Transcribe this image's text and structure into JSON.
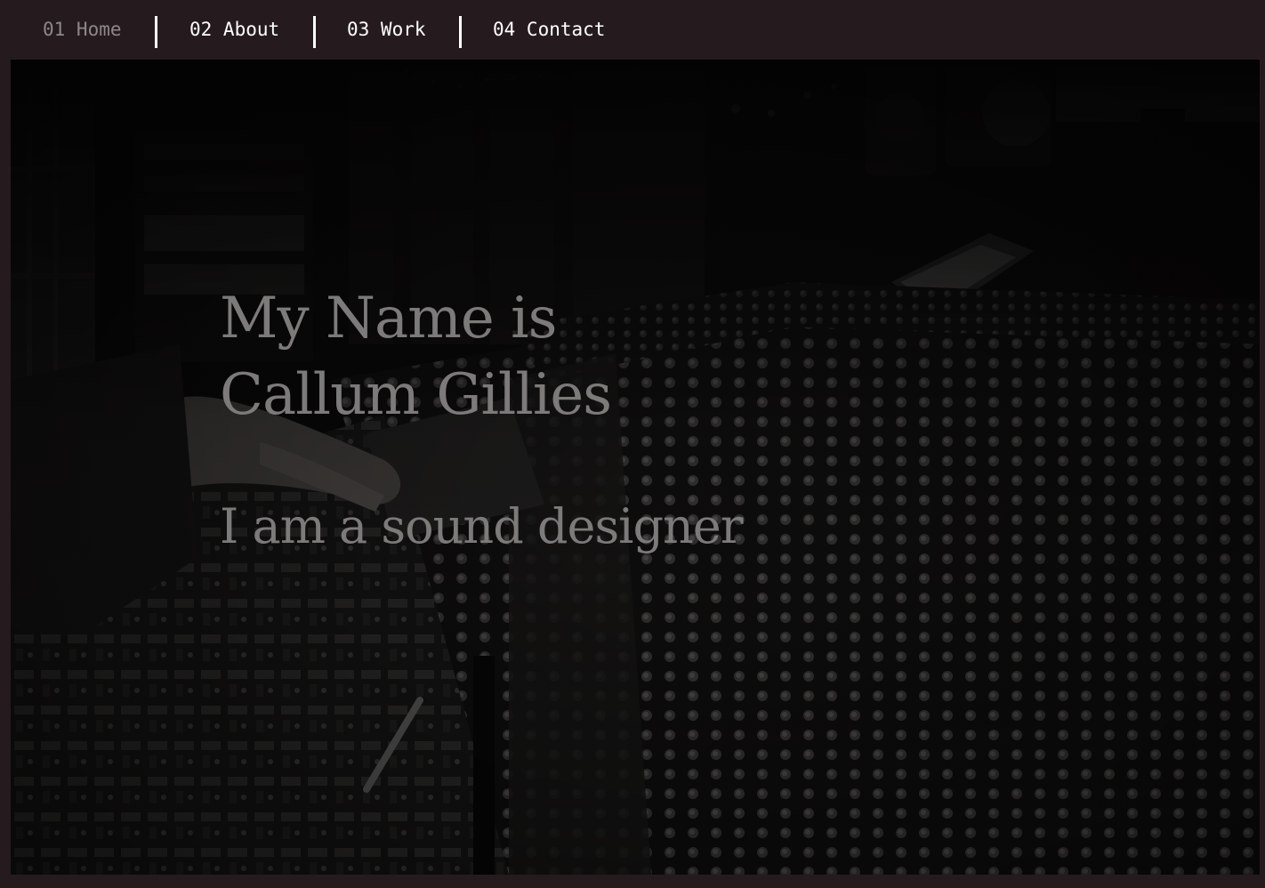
{
  "nav": {
    "items": [
      {
        "label": "01 Home",
        "active": true
      },
      {
        "label": "02 About",
        "active": false
      },
      {
        "label": "03 Work",
        "active": false
      },
      {
        "label": "04 Contact",
        "active": false
      }
    ]
  },
  "hero": {
    "title_line1": "My Name is",
    "title_line2": "Callum Gillies",
    "subtitle": "I am a sound designer",
    "background_image": "mixing-console-photo"
  },
  "colors": {
    "page_background": "#251b1e",
    "nav_text": "#ffffff",
    "nav_active_text": "#8d8789",
    "hero_text": "#7d7a7a"
  }
}
